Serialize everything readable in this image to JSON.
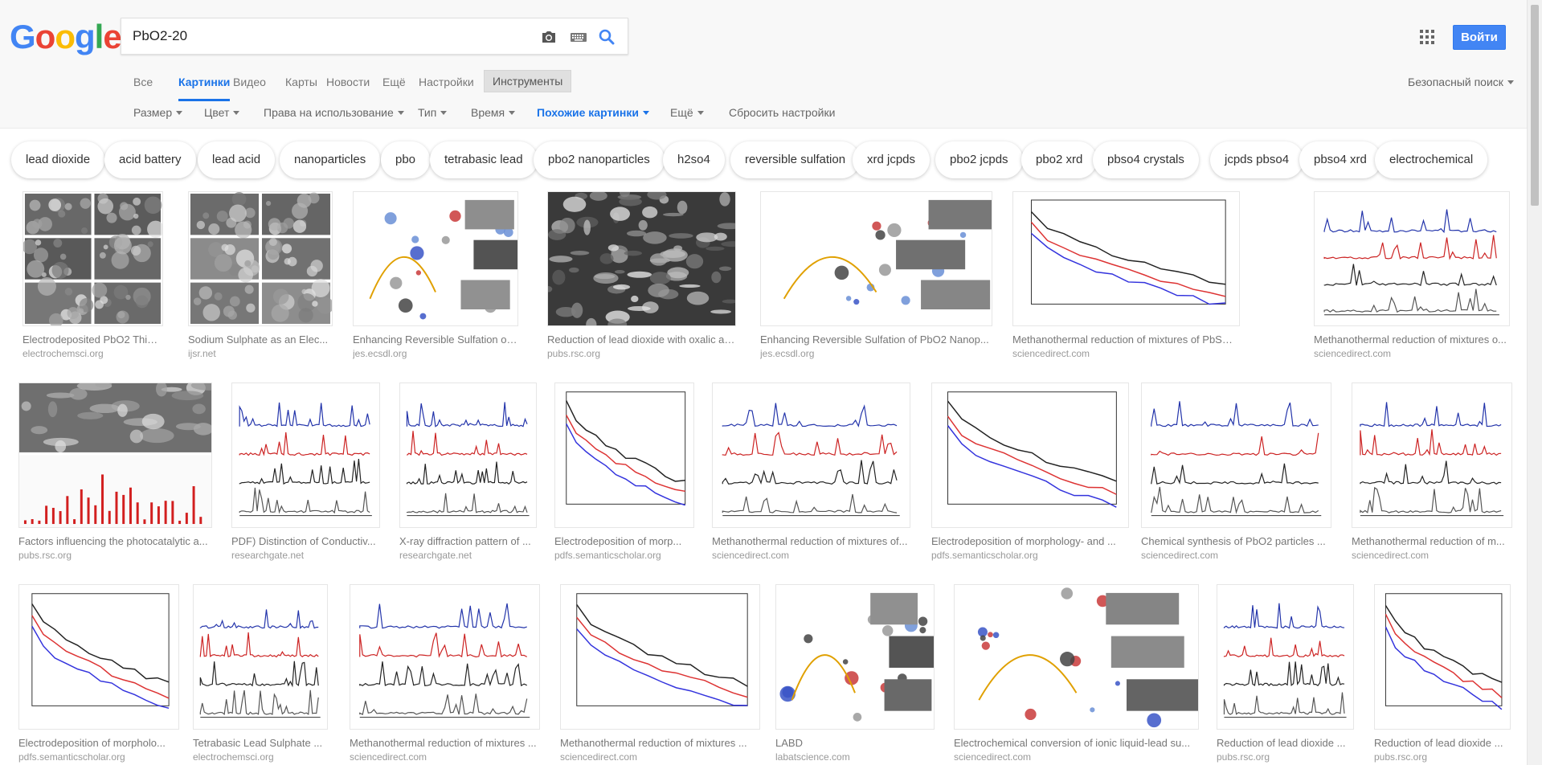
{
  "logo": {
    "letters": [
      "G",
      "o",
      "o",
      "g",
      "l",
      "e"
    ],
    "colors": [
      "#4285f4",
      "#ea4335",
      "#fbbc05",
      "#4285f4",
      "#34a853",
      "#ea4335"
    ]
  },
  "search": {
    "query": "PbO2-20"
  },
  "header": {
    "login_label": "Войти",
    "safesearch_label": "Безопасный поиск"
  },
  "tabs": [
    {
      "label": "Все"
    },
    {
      "label": "Картинки",
      "active": true
    },
    {
      "label": "Видео"
    },
    {
      "label": "Карты"
    },
    {
      "label": "Новости"
    },
    {
      "label": "Ещё"
    },
    {
      "label": "Настройки"
    },
    {
      "label": "Инструменты"
    }
  ],
  "filters": [
    {
      "label": "Размер"
    },
    {
      "label": "Цвет"
    },
    {
      "label": "Права на использование"
    },
    {
      "label": "Тип"
    },
    {
      "label": "Время"
    },
    {
      "label": "Похожие картинки",
      "active": true
    },
    {
      "label": "Ещё"
    },
    {
      "label": "Сбросить настройки"
    }
  ],
  "chips": [
    "lead dioxide",
    "acid battery",
    "lead acid",
    "nanoparticles",
    "pbo",
    "tetrabasic lead",
    "pbo2 nanoparticles",
    "h2so4",
    "reversible sulfation",
    "xrd jcpds",
    "pbo2 jcpds",
    "pbo2 xrd",
    "pbso4 crystals",
    "jcpds pbso4",
    "pbso4 xrd",
    "electrochemical"
  ],
  "results": [
    [
      {
        "title": "Electrodeposited PbO2 Thin ...",
        "source": "electrochemsci.org",
        "kind": "sem-grid"
      },
      {
        "title": "Sodium Sulphate as an Elec...",
        "source": "ijsr.net",
        "kind": "sem-grid"
      },
      {
        "title": "Enhancing Reversible Sulfation of ...",
        "source": "jes.ecsdl.org",
        "kind": "scheme"
      },
      {
        "title": "Reduction of lead dioxide with oxalic aci...",
        "source": "pubs.rsc.org",
        "kind": "sem-dark"
      },
      {
        "title": "Enhancing Reversible Sulfation of PbO2 Nanop...",
        "source": "jes.ecsdl.org",
        "kind": "scheme"
      },
      {
        "title": "Methanothermal reduction of mixtures of PbSO4 and PbO2...",
        "source": "sciencedirect.com",
        "kind": "line-chart"
      },
      {
        "title": "Methanothermal reduction of mixtures o...",
        "source": "sciencedirect.com",
        "kind": "xrd"
      }
    ],
    [
      {
        "title": "Factors influencing the photocatalytic a...",
        "source": "pubs.rsc.org",
        "kind": "tem-eds"
      },
      {
        "title": "PDF) Distinction of Conductiv...",
        "source": "researchgate.net",
        "kind": "xrd"
      },
      {
        "title": "X-ray diffraction pattern of ...",
        "source": "researchgate.net",
        "kind": "xrd"
      },
      {
        "title": "Electrodeposition of morp...",
        "source": "pdfs.semanticscholar.org",
        "kind": "line-chart"
      },
      {
        "title": "Methanothermal reduction of mixtures of...",
        "source": "sciencedirect.com",
        "kind": "xrd"
      },
      {
        "title": "Electrodeposition of morphology- and ...",
        "source": "pdfs.semanticscholar.org",
        "kind": "line-chart"
      },
      {
        "title": "Chemical synthesis of PbO2 particles ...",
        "source": "sciencedirect.com",
        "kind": "xrd"
      },
      {
        "title": "Methanothermal reduction of m...",
        "source": "sciencedirect.com",
        "kind": "xrd"
      }
    ],
    [
      {
        "title": "Electrodeposition of morpholo...",
        "source": "pdfs.semanticscholar.org",
        "kind": "line-chart"
      },
      {
        "title": "Tetrabasic Lead Sulphate ...",
        "source": "electrochemsci.org",
        "kind": "xrd"
      },
      {
        "title": "Methanothermal reduction of mixtures ...",
        "source": "sciencedirect.com",
        "kind": "xrd"
      },
      {
        "title": "Methanothermal reduction of mixtures ...",
        "source": "sciencedirect.com",
        "kind": "line-chart"
      },
      {
        "title": "LABD",
        "source": "labatscience.com",
        "kind": "scheme"
      },
      {
        "title": "Electrochemical conversion of ionic liquid-lead su...",
        "source": "sciencedirect.com",
        "kind": "scheme"
      },
      {
        "title": "Reduction of lead dioxide ...",
        "source": "pubs.rsc.org",
        "kind": "xrd"
      },
      {
        "title": "Reduction of lead dioxide ...",
        "source": "pubs.rsc.org",
        "kind": "line-chart"
      }
    ]
  ]
}
